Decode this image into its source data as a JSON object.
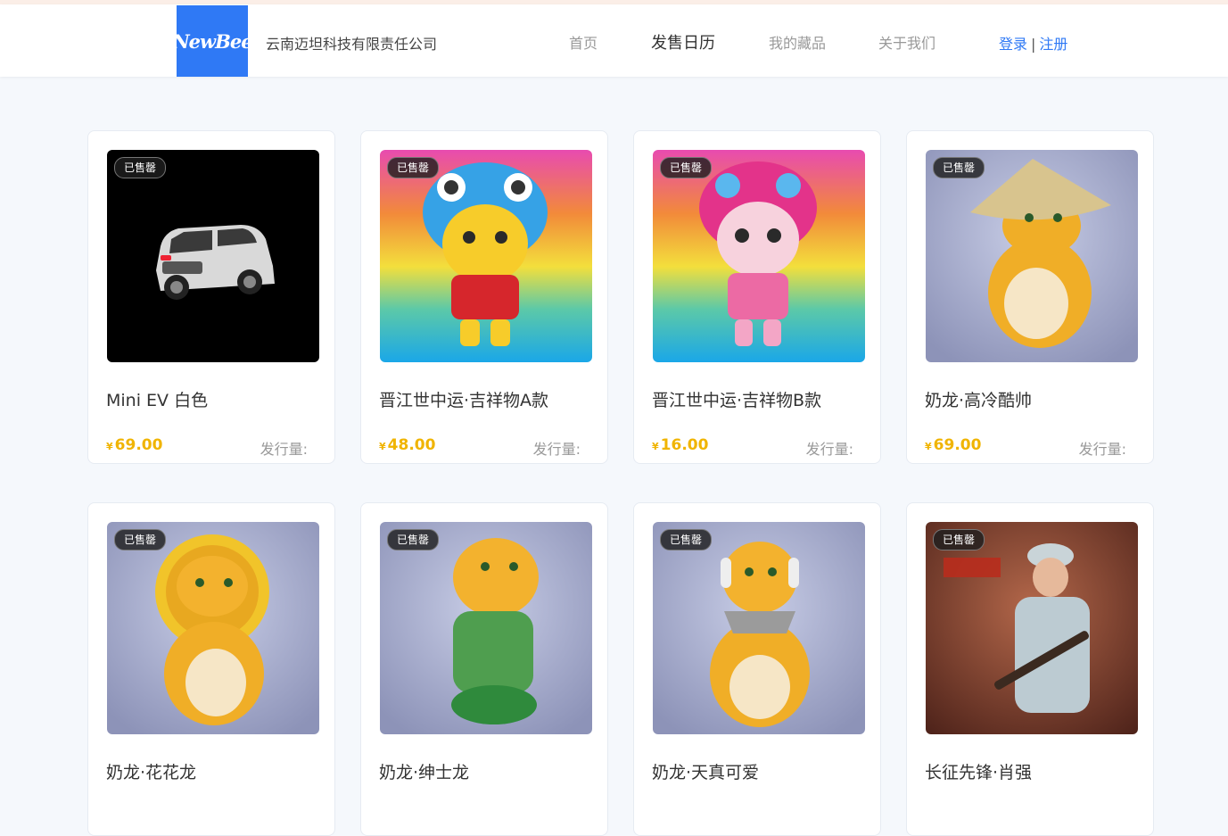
{
  "header": {
    "logo_text": "NewBee",
    "company": "云南迈坦科技有限责任公司",
    "nav": [
      "首页",
      "发售日历",
      "我的藏品",
      "关于我们"
    ],
    "active_nav": "发售日历",
    "login": "登录",
    "separator": "|",
    "register": "注册"
  },
  "products": [
    {
      "badge": "已售罄",
      "title": "Mini EV 白色",
      "currency": "¥",
      "price": "69.00",
      "issue_label": "发行量:",
      "image": "white-mini-ev-car"
    },
    {
      "badge": "已售罄",
      "title": "晋江世中运·吉祥物A款",
      "currency": "¥",
      "price": "48.00",
      "issue_label": "发行量:",
      "image": "mascot-a-blue-hood"
    },
    {
      "badge": "已售罄",
      "title": "晋江世中运·吉祥物B款",
      "currency": "¥",
      "price": "16.00",
      "issue_label": "发行量:",
      "image": "mascot-b-pink-hood"
    },
    {
      "badge": "已售罄",
      "title": "奶龙·高冷酷帅",
      "currency": "¥",
      "price": "69.00",
      "issue_label": "发行量:",
      "image": "dragon-straw-hat"
    },
    {
      "badge": "已售罄",
      "title": "奶龙·花花龙",
      "image": "dragon-sunflower"
    },
    {
      "badge": "已售罄",
      "title": "奶龙·绅士龙",
      "image": "dragon-gentleman"
    },
    {
      "badge": "已售罄",
      "title": "奶龙·天真可爱",
      "image": "dragon-headphones"
    },
    {
      "badge": "已售罄",
      "title": "长征先锋·肖强",
      "image": "soldier-long-march"
    }
  ],
  "colors": {
    "accent": "#2f79f5",
    "price": "#f0b400"
  }
}
